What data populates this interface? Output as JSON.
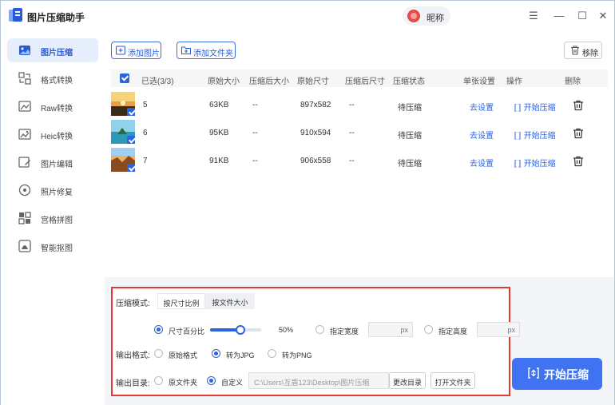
{
  "app": {
    "title": "图片压缩助手",
    "nickname": "昵称"
  },
  "window_controls": {
    "menu": "☰",
    "minimize": "—",
    "maximize": "☐",
    "close": "✕"
  },
  "sidebar": {
    "items": [
      {
        "label": "图片压缩",
        "icon": "image-compress-icon",
        "active": true
      },
      {
        "label": "格式转换",
        "icon": "format-convert-icon"
      },
      {
        "label": "Raw转换",
        "icon": "raw-convert-icon"
      },
      {
        "label": "Heic转换",
        "icon": "heic-convert-icon"
      },
      {
        "label": "图片编辑",
        "icon": "image-edit-icon"
      },
      {
        "label": "照片修复",
        "icon": "photo-repair-icon"
      },
      {
        "label": "宫格拼图",
        "icon": "grid-collage-icon"
      },
      {
        "label": "智能抠图",
        "icon": "smart-cutout-icon"
      }
    ]
  },
  "toolbar": {
    "add_image": "添加图片",
    "add_folder": "添加文件夹",
    "remove": "移除"
  },
  "table": {
    "headers": {
      "selected": "已选(3/3)",
      "orig_size": "原始大小",
      "comp_size": "压缩后大小",
      "orig_dim": "原始尺寸",
      "comp_dim": "压缩后尺寸",
      "status": "压缩状态",
      "single": "单张设置",
      "action": "操作",
      "delete": "删除"
    },
    "rows": [
      {
        "name": "5",
        "orig_size": "63KB",
        "comp_size": "--",
        "orig_dim": "897x582",
        "comp_dim": "--",
        "status": "待压缩",
        "setting": "去设置",
        "action": "开始压缩"
      },
      {
        "name": "6",
        "orig_size": "95KB",
        "comp_size": "--",
        "orig_dim": "910x594",
        "comp_dim": "--",
        "status": "待压缩",
        "setting": "去设置",
        "action": "开始压缩"
      },
      {
        "name": "7",
        "orig_size": "91KB",
        "comp_size": "--",
        "orig_dim": "906x558",
        "comp_dim": "--",
        "status": "待压缩",
        "setting": "去设置",
        "action": "开始压缩"
      }
    ]
  },
  "settings": {
    "mode_label": "压缩模式:",
    "mode_tabs": [
      "按尺寸比例",
      "按文件大小"
    ],
    "size_percent_label": "尺寸百分比",
    "slider_value": "50%",
    "slider_fraction": 0.5,
    "width_label": "指定宽度",
    "height_label": "指定高度",
    "px": "px",
    "format_label": "输出格式:",
    "formats": [
      "原始格式",
      "转为JPG",
      "转为PNG"
    ],
    "selected_format": "转为JPG",
    "dir_label": "输出目录:",
    "dir_options": [
      "原文件夹",
      "自定义"
    ],
    "selected_dir": "自定义",
    "dir_path": "C:\\Users\\互盾123\\Desktop\\图片压缩",
    "change_dir": "更改目录",
    "open_folder": "打开文件夹"
  },
  "start_button": "开始压缩",
  "colors": {
    "accent": "#2a62e0",
    "highlight_border": "#e53935"
  }
}
